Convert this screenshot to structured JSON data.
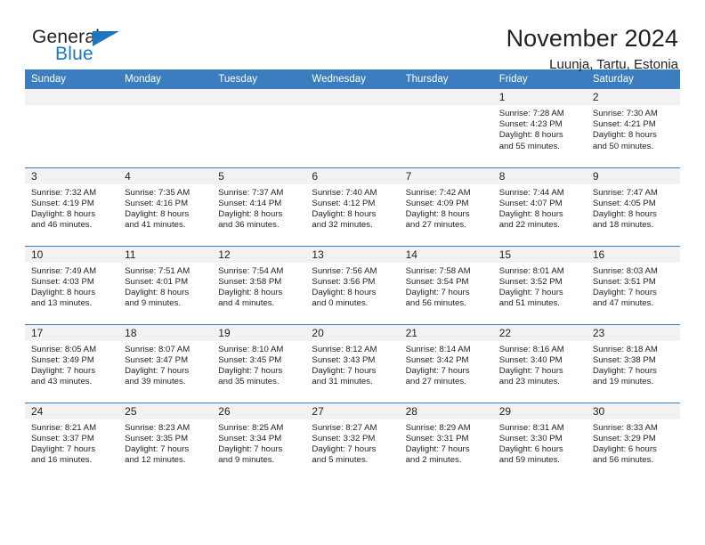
{
  "brand": {
    "word1": "General",
    "word2": "Blue",
    "accent_color": "#1b76bc"
  },
  "header": {
    "title": "November 2024",
    "subtitle": "Luunja, Tartu, Estonia"
  },
  "theme": {
    "header_blue": "#3b7dbf",
    "daynum_gray": "#f2f2f2",
    "text": "#231f20"
  },
  "weekday_headers": [
    "Sunday",
    "Monday",
    "Tuesday",
    "Wednesday",
    "Thursday",
    "Friday",
    "Saturday"
  ],
  "weeks": [
    [
      {
        "day": "",
        "sunrise": "",
        "sunset": "",
        "daylight1": "",
        "daylight2": ""
      },
      {
        "day": "",
        "sunrise": "",
        "sunset": "",
        "daylight1": "",
        "daylight2": ""
      },
      {
        "day": "",
        "sunrise": "",
        "sunset": "",
        "daylight1": "",
        "daylight2": ""
      },
      {
        "day": "",
        "sunrise": "",
        "sunset": "",
        "daylight1": "",
        "daylight2": ""
      },
      {
        "day": "",
        "sunrise": "",
        "sunset": "",
        "daylight1": "",
        "daylight2": ""
      },
      {
        "day": "1",
        "sunrise": "Sunrise: 7:28 AM",
        "sunset": "Sunset: 4:23 PM",
        "daylight1": "Daylight: 8 hours",
        "daylight2": "and 55 minutes."
      },
      {
        "day": "2",
        "sunrise": "Sunrise: 7:30 AM",
        "sunset": "Sunset: 4:21 PM",
        "daylight1": "Daylight: 8 hours",
        "daylight2": "and 50 minutes."
      }
    ],
    [
      {
        "day": "3",
        "sunrise": "Sunrise: 7:32 AM",
        "sunset": "Sunset: 4:19 PM",
        "daylight1": "Daylight: 8 hours",
        "daylight2": "and 46 minutes."
      },
      {
        "day": "4",
        "sunrise": "Sunrise: 7:35 AM",
        "sunset": "Sunset: 4:16 PM",
        "daylight1": "Daylight: 8 hours",
        "daylight2": "and 41 minutes."
      },
      {
        "day": "5",
        "sunrise": "Sunrise: 7:37 AM",
        "sunset": "Sunset: 4:14 PM",
        "daylight1": "Daylight: 8 hours",
        "daylight2": "and 36 minutes."
      },
      {
        "day": "6",
        "sunrise": "Sunrise: 7:40 AM",
        "sunset": "Sunset: 4:12 PM",
        "daylight1": "Daylight: 8 hours",
        "daylight2": "and 32 minutes."
      },
      {
        "day": "7",
        "sunrise": "Sunrise: 7:42 AM",
        "sunset": "Sunset: 4:09 PM",
        "daylight1": "Daylight: 8 hours",
        "daylight2": "and 27 minutes."
      },
      {
        "day": "8",
        "sunrise": "Sunrise: 7:44 AM",
        "sunset": "Sunset: 4:07 PM",
        "daylight1": "Daylight: 8 hours",
        "daylight2": "and 22 minutes."
      },
      {
        "day": "9",
        "sunrise": "Sunrise: 7:47 AM",
        "sunset": "Sunset: 4:05 PM",
        "daylight1": "Daylight: 8 hours",
        "daylight2": "and 18 minutes."
      }
    ],
    [
      {
        "day": "10",
        "sunrise": "Sunrise: 7:49 AM",
        "sunset": "Sunset: 4:03 PM",
        "daylight1": "Daylight: 8 hours",
        "daylight2": "and 13 minutes."
      },
      {
        "day": "11",
        "sunrise": "Sunrise: 7:51 AM",
        "sunset": "Sunset: 4:01 PM",
        "daylight1": "Daylight: 8 hours",
        "daylight2": "and 9 minutes."
      },
      {
        "day": "12",
        "sunrise": "Sunrise: 7:54 AM",
        "sunset": "Sunset: 3:58 PM",
        "daylight1": "Daylight: 8 hours",
        "daylight2": "and 4 minutes."
      },
      {
        "day": "13",
        "sunrise": "Sunrise: 7:56 AM",
        "sunset": "Sunset: 3:56 PM",
        "daylight1": "Daylight: 8 hours",
        "daylight2": "and 0 minutes."
      },
      {
        "day": "14",
        "sunrise": "Sunrise: 7:58 AM",
        "sunset": "Sunset: 3:54 PM",
        "daylight1": "Daylight: 7 hours",
        "daylight2": "and 56 minutes."
      },
      {
        "day": "15",
        "sunrise": "Sunrise: 8:01 AM",
        "sunset": "Sunset: 3:52 PM",
        "daylight1": "Daylight: 7 hours",
        "daylight2": "and 51 minutes."
      },
      {
        "day": "16",
        "sunrise": "Sunrise: 8:03 AM",
        "sunset": "Sunset: 3:51 PM",
        "daylight1": "Daylight: 7 hours",
        "daylight2": "and 47 minutes."
      }
    ],
    [
      {
        "day": "17",
        "sunrise": "Sunrise: 8:05 AM",
        "sunset": "Sunset: 3:49 PM",
        "daylight1": "Daylight: 7 hours",
        "daylight2": "and 43 minutes."
      },
      {
        "day": "18",
        "sunrise": "Sunrise: 8:07 AM",
        "sunset": "Sunset: 3:47 PM",
        "daylight1": "Daylight: 7 hours",
        "daylight2": "and 39 minutes."
      },
      {
        "day": "19",
        "sunrise": "Sunrise: 8:10 AM",
        "sunset": "Sunset: 3:45 PM",
        "daylight1": "Daylight: 7 hours",
        "daylight2": "and 35 minutes."
      },
      {
        "day": "20",
        "sunrise": "Sunrise: 8:12 AM",
        "sunset": "Sunset: 3:43 PM",
        "daylight1": "Daylight: 7 hours",
        "daylight2": "and 31 minutes."
      },
      {
        "day": "21",
        "sunrise": "Sunrise: 8:14 AM",
        "sunset": "Sunset: 3:42 PM",
        "daylight1": "Daylight: 7 hours",
        "daylight2": "and 27 minutes."
      },
      {
        "day": "22",
        "sunrise": "Sunrise: 8:16 AM",
        "sunset": "Sunset: 3:40 PM",
        "daylight1": "Daylight: 7 hours",
        "daylight2": "and 23 minutes."
      },
      {
        "day": "23",
        "sunrise": "Sunrise: 8:18 AM",
        "sunset": "Sunset: 3:38 PM",
        "daylight1": "Daylight: 7 hours",
        "daylight2": "and 19 minutes."
      }
    ],
    [
      {
        "day": "24",
        "sunrise": "Sunrise: 8:21 AM",
        "sunset": "Sunset: 3:37 PM",
        "daylight1": "Daylight: 7 hours",
        "daylight2": "and 16 minutes."
      },
      {
        "day": "25",
        "sunrise": "Sunrise: 8:23 AM",
        "sunset": "Sunset: 3:35 PM",
        "daylight1": "Daylight: 7 hours",
        "daylight2": "and 12 minutes."
      },
      {
        "day": "26",
        "sunrise": "Sunrise: 8:25 AM",
        "sunset": "Sunset: 3:34 PM",
        "daylight1": "Daylight: 7 hours",
        "daylight2": "and 9 minutes."
      },
      {
        "day": "27",
        "sunrise": "Sunrise: 8:27 AM",
        "sunset": "Sunset: 3:32 PM",
        "daylight1": "Daylight: 7 hours",
        "daylight2": "and 5 minutes."
      },
      {
        "day": "28",
        "sunrise": "Sunrise: 8:29 AM",
        "sunset": "Sunset: 3:31 PM",
        "daylight1": "Daylight: 7 hours",
        "daylight2": "and 2 minutes."
      },
      {
        "day": "29",
        "sunrise": "Sunrise: 8:31 AM",
        "sunset": "Sunset: 3:30 PM",
        "daylight1": "Daylight: 6 hours",
        "daylight2": "and 59 minutes."
      },
      {
        "day": "30",
        "sunrise": "Sunrise: 8:33 AM",
        "sunset": "Sunset: 3:29 PM",
        "daylight1": "Daylight: 6 hours",
        "daylight2": "and 56 minutes."
      }
    ]
  ]
}
